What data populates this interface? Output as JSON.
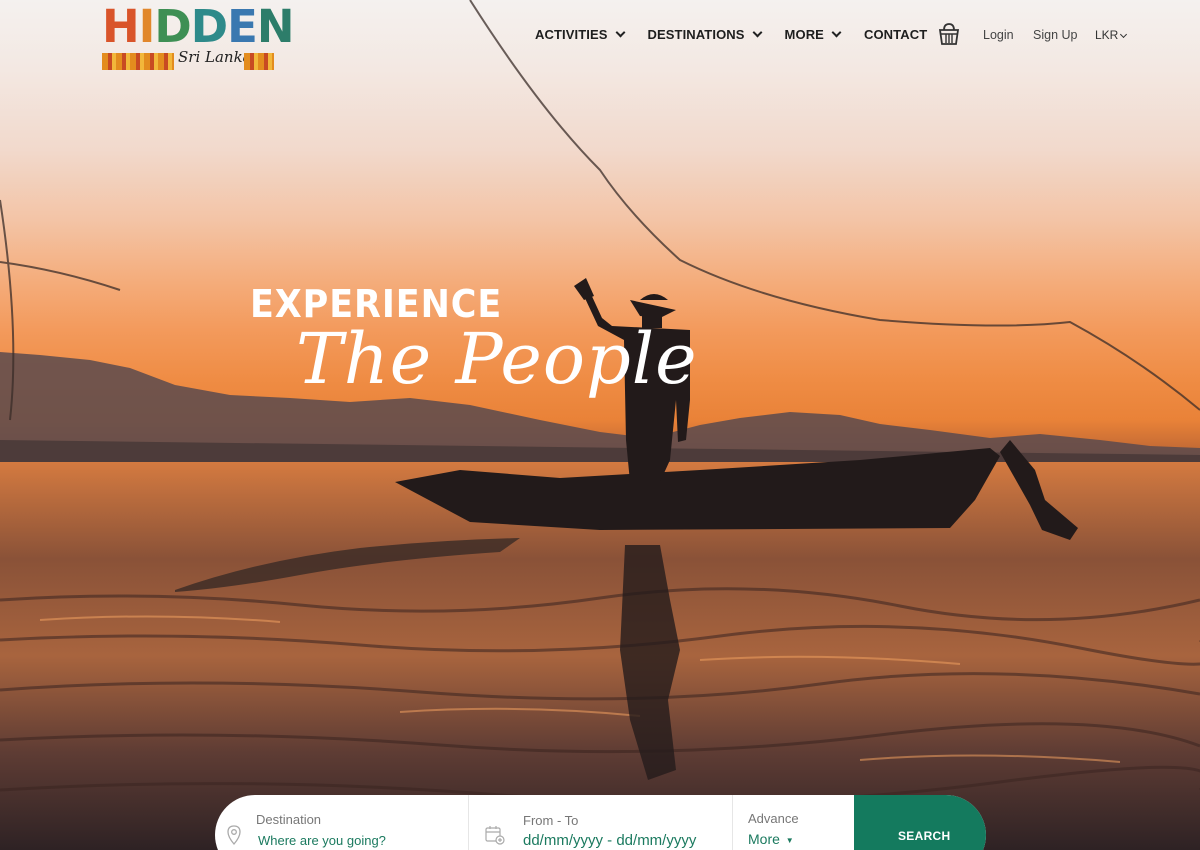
{
  "brand": {
    "logo_word": "HIDDEN",
    "logo_sub": "Sri Lanka"
  },
  "nav": {
    "items": [
      {
        "label": "ACTIVITIES",
        "has_dropdown": true
      },
      {
        "label": "DESTINATIONS",
        "has_dropdown": true
      },
      {
        "label": "MORE",
        "has_dropdown": true
      },
      {
        "label": "CONTACT",
        "has_dropdown": false
      }
    ],
    "cart_icon": "basket-icon",
    "login_label": "Login",
    "signup_label": "Sign Up",
    "currency_label": "LKR"
  },
  "hero": {
    "headline": "EXPERIENCE",
    "tagline": "The People"
  },
  "search": {
    "destination": {
      "label": "Destination",
      "placeholder": "Where are you going?",
      "icon": "location-pin-icon"
    },
    "dates": {
      "label": "From - To",
      "placeholder": "dd/mm/yyyy - dd/mm/yyyy",
      "icon": "calendar-add-icon"
    },
    "advance": {
      "label": "Advance",
      "value": "More"
    },
    "button_label": "SEARCH"
  },
  "colors": {
    "accent": "#147a5e",
    "accent_text": "#1b7a5f"
  }
}
